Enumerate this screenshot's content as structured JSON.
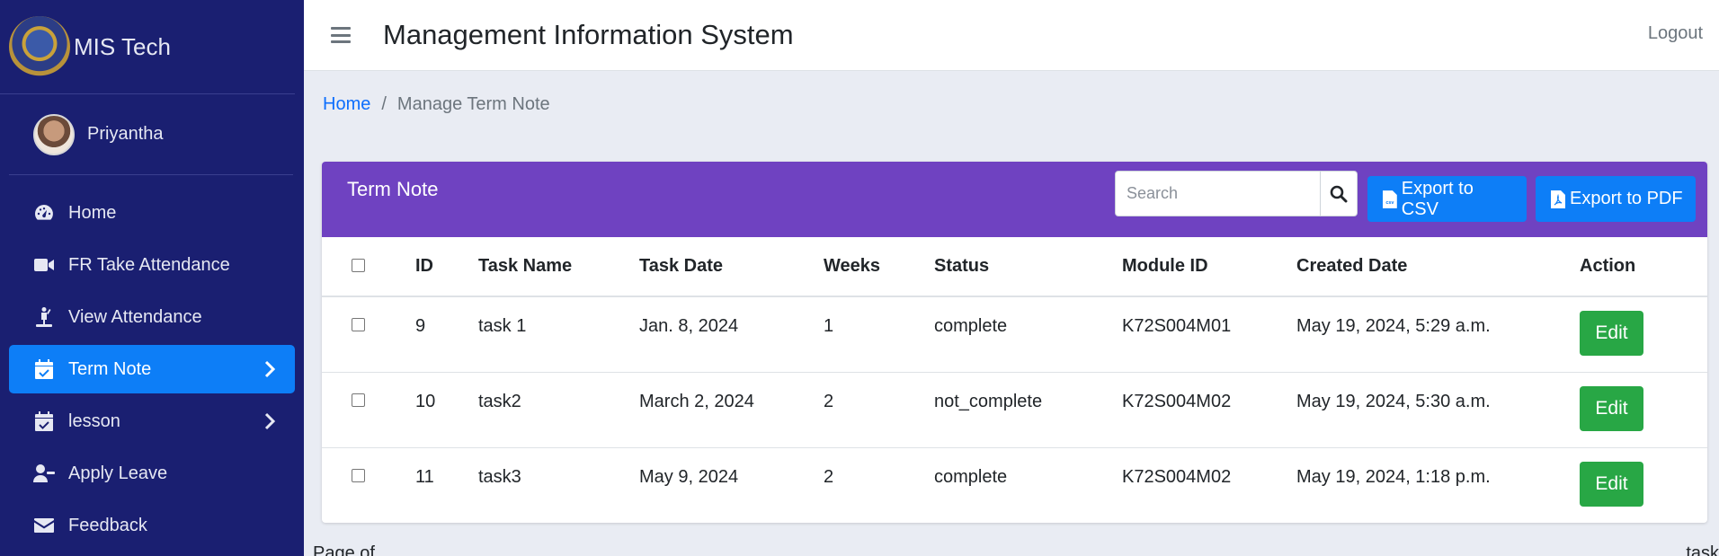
{
  "brand": {
    "name": "MIS Tech"
  },
  "user": {
    "name": "Priyantha"
  },
  "sidebar": {
    "items": [
      {
        "label": "Home",
        "icon": "dashboard-gauge-icon"
      },
      {
        "label": "FR Take Attendance",
        "icon": "video-camera-icon"
      },
      {
        "label": "View Attendance",
        "icon": "person-raised-hand-icon"
      },
      {
        "label": "Term Note",
        "icon": "calendar-check-icon",
        "active": true
      },
      {
        "label": "lesson",
        "icon": "calendar-check-icon"
      },
      {
        "label": "Apply Leave",
        "icon": "user-minus-icon"
      },
      {
        "label": "Feedback",
        "icon": "envelope-icon"
      }
    ]
  },
  "header": {
    "title": "Management Information System",
    "logout_label": "Logout"
  },
  "breadcrumb": {
    "home": "Home",
    "separator": "/",
    "current": "Manage Term Note"
  },
  "card": {
    "title": "Term Note",
    "search_placeholder": "Search",
    "export_csv_label": "Export to CSV",
    "export_pdf_label": "Export to PDF",
    "csv_icon_text": "csv"
  },
  "table": {
    "columns": [
      "ID",
      "Task Name",
      "Task Date",
      "Weeks",
      "Status",
      "Module ID",
      "Created Date",
      "Action"
    ],
    "rows": [
      {
        "id": "9",
        "task_name": "task 1",
        "task_date": "Jan. 8, 2024",
        "weeks": "1",
        "status": "complete",
        "module_id": "K72S004M01",
        "created": "May 19, 2024, 5:29 a.m.",
        "action": "Edit"
      },
      {
        "id": "10",
        "task_name": "task2",
        "task_date": "March 2, 2024",
        "weeks": "2",
        "status": "not_complete",
        "module_id": "K72S004M02",
        "created": "May 19, 2024, 5:30 a.m.",
        "action": "Edit"
      },
      {
        "id": "11",
        "task_name": "task3",
        "task_date": "May 9, 2024",
        "weeks": "2",
        "status": "complete",
        "module_id": "K72S004M02",
        "created": "May 19, 2024, 1:18 p.m.",
        "action": "Edit"
      }
    ]
  },
  "footer": {
    "page_text": "Page of",
    "right_text": "task"
  },
  "colors": {
    "sidebar_bg": "#1a1f71",
    "accent_blue": "#0d7ef7",
    "card_header": "#6f42c1",
    "edit_green": "#28a745"
  }
}
